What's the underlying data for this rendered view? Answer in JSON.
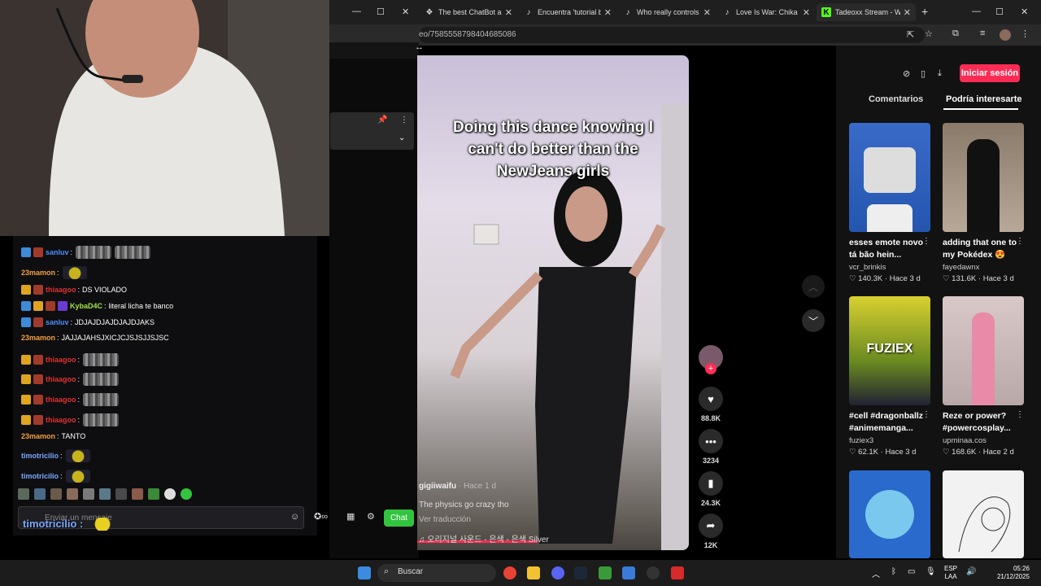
{
  "browser": {
    "tabs": [
      {
        "label": "The best ChatBot an",
        "icon": "chatgpt-icon"
      },
      {
        "label": "Encuentra 'tutorial be",
        "icon": "tiktok-icon"
      },
      {
        "label": "Who really controls th",
        "icon": "tiktok-icon"
      },
      {
        "label": "Love Is War: Chika Da",
        "icon": "tiktok-icon"
      },
      {
        "label": "Tadeoxx Stream - Wa",
        "icon": "kick-icon"
      }
    ],
    "url": "eo/7585558798404685086"
  },
  "chat": {
    "messages": [
      {
        "user": "sanluv",
        "color": "#4a90ff",
        "text": "",
        "badges": [
          "blue",
          "red"
        ],
        "emotes": 2
      },
      {
        "user": "23mamon",
        "color": "#f4a040",
        "text": "",
        "badges": [],
        "emotes": 1
      },
      {
        "user": "thiaagoo",
        "color": "#e03030",
        "text": "DS VIOLADO",
        "badges": [
          "gold",
          "red"
        ],
        "emotes": 0
      },
      {
        "user": "KybaD4C",
        "color": "#a0e040",
        "text": "literal licha te banco",
        "badges": [
          "blue",
          "gold",
          "red",
          "purple"
        ],
        "emotes": 0
      },
      {
        "user": "sanluv",
        "color": "#4a90ff",
        "text": "JDJAJDJAJDJAJDJAKS",
        "badges": [
          "blue",
          "red"
        ],
        "emotes": 0
      },
      {
        "user": "23mamon",
        "color": "#f4a040",
        "text": "JAJJAJAHSJXICJCJSJSJJSJSC",
        "badges": [],
        "emotes": 0
      },
      {
        "user": "thiaagoo",
        "color": "#e03030",
        "text": "",
        "badges": [
          "gold",
          "red"
        ],
        "emotes": 1
      },
      {
        "user": "thiaagoo",
        "color": "#e03030",
        "text": "",
        "badges": [
          "gold",
          "red"
        ],
        "emotes": 1
      },
      {
        "user": "thiaagoo",
        "color": "#e03030",
        "text": "",
        "badges": [
          "gold",
          "red"
        ],
        "emotes": 1
      },
      {
        "user": "thiaagoo",
        "color": "#e03030",
        "text": "",
        "badges": [
          "gold",
          "red"
        ],
        "emotes": 1
      },
      {
        "user": "23mamon",
        "color": "#f4a040",
        "text": "TANTO",
        "badges": [],
        "emotes": 0
      },
      {
        "user": "timotricilio",
        "color": "#7aa7ff",
        "text": "",
        "badges": [],
        "emotes": 1
      },
      {
        "user": "timotricilio",
        "color": "#7aa7ff",
        "text": "",
        "badges": [],
        "emotes": 1
      }
    ],
    "input_placeholder": "Enviar un mensaje",
    "overlay_user": "timotricilio :",
    "chat_button": "Chat"
  },
  "video": {
    "caption": "Doing this dance knowing I can't do better than the NewJeans girls",
    "author": "gigiiwaifu",
    "age": "· Hace 1 d",
    "description": "The physics go crazy tho",
    "translate": "Ver traducción",
    "music": "♫  오리지널 사운드 - 은색 - 은색 Silver",
    "likes": "88.8K",
    "comments": "3234",
    "saves": "24.3K",
    "shares": "12K"
  },
  "sidebar": {
    "login_button": "Iniciar sesión",
    "tabs": [
      "Comentarios",
      "Podría interesarte"
    ],
    "videos": [
      {
        "title": "esses emote novo tá bão hein...",
        "author": "vcr_brinkis",
        "likes": "140.3K",
        "age": "Hace 3 d"
      },
      {
        "title": "adding that one to my Pokédex 😍",
        "author": "fayedawnx",
        "likes": "131.6K",
        "age": "Hace 3 d"
      },
      {
        "title": "#cell #dragonballz #animemanga...",
        "author": "fuziex3",
        "likes": "62.1K",
        "age": "Hace 3 d"
      },
      {
        "title": "Reze or power? #powercosplay...",
        "author": "upminaa.cos",
        "likes": "168.6K",
        "age": "Hace 2 d"
      }
    ],
    "thumb_text": "FUZIEX"
  },
  "taskbar": {
    "search": "Buscar",
    "lang1": "ESP",
    "lang2": "LAA",
    "time": "05:26",
    "date": "21/12/2025"
  },
  "colors": {
    "accent": "#fe2c55",
    "chat_button": "#33c43f"
  }
}
